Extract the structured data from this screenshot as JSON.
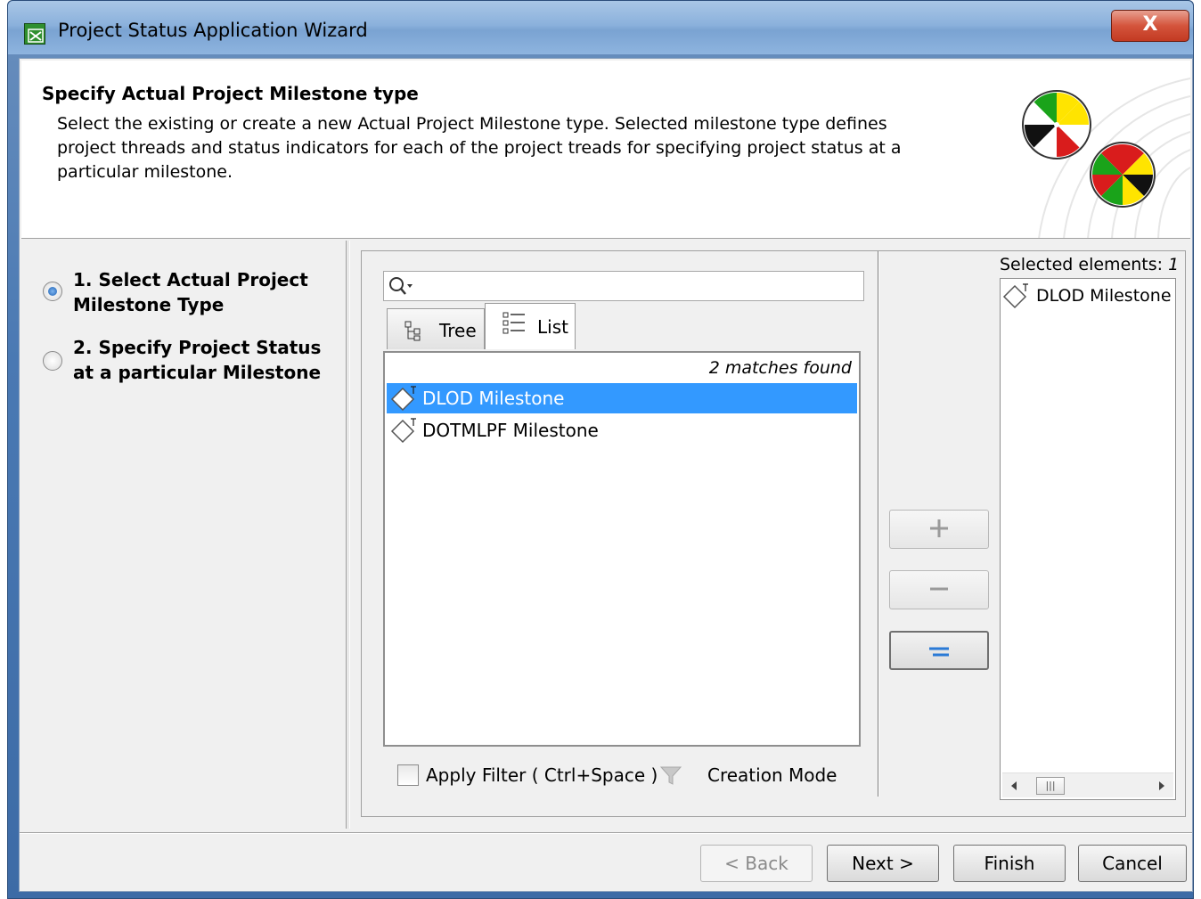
{
  "window": {
    "title": "Project Status Application Wizard",
    "close_label": "X"
  },
  "header": {
    "title": "Specify Actual Project Milestone type",
    "description": "Select the existing or create a new Actual Project Milestone type. Selected milestone type defines project threads and status indicators for each of the project treads for specifying project status at a particular milestone."
  },
  "steps": [
    {
      "label": "1. Select Actual Project Milestone Type",
      "selected": true
    },
    {
      "label": "2. Specify Project Status at a particular Milestone",
      "selected": false
    }
  ],
  "search": {
    "value": "",
    "placeholder": ""
  },
  "tabs": [
    {
      "label": "Tree",
      "active": false
    },
    {
      "label": "List",
      "active": true
    }
  ],
  "results": {
    "match_info": "2 matches found",
    "items": [
      {
        "label": "DLOD Milestone",
        "selected": true
      },
      {
        "label": "DOTMLPF Milestone",
        "selected": false
      }
    ]
  },
  "filter": {
    "apply_label": "Apply Filter ( Ctrl+Space )",
    "apply_checked": false,
    "creation_mode_label": "Creation Mode"
  },
  "move_buttons": {
    "add": "+",
    "remove": "−",
    "replace": "="
  },
  "selected": {
    "title_prefix": "Selected elements: ",
    "count": "1",
    "items": [
      "DLOD Milestone"
    ]
  },
  "footer": {
    "back": "< Back",
    "next": "Next >",
    "finish": "Finish",
    "cancel": "Cancel"
  },
  "colors": {
    "selection": "#3399ff",
    "titlebar": "#8bb1dc",
    "close_button": "#d4543c"
  }
}
